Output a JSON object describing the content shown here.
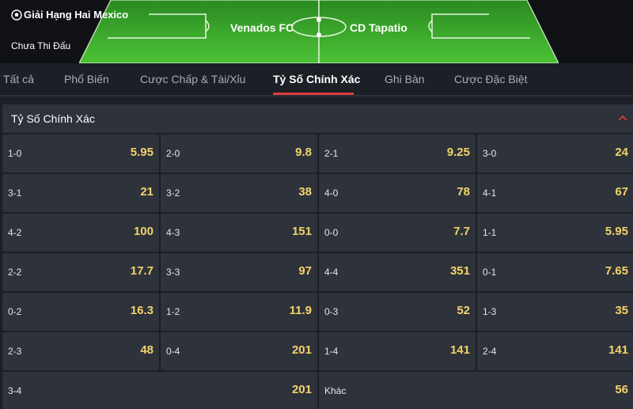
{
  "match": {
    "league": "Giải Hạng Hai Mexico",
    "status": "Chưa Thi Đấu",
    "home_team": "Venados FC",
    "away_team": "CD Tapatio",
    "league_icon": "soccer-ball-icon"
  },
  "tabs": [
    {
      "label": "Tất cả",
      "active": false
    },
    {
      "label": "Phổ Biến",
      "active": false
    },
    {
      "label": "Cược Chấp & Tài/Xỉu",
      "active": false
    },
    {
      "label": "Tỷ Số Chính Xác",
      "active": true
    },
    {
      "label": "Ghi Bàn",
      "active": false
    },
    {
      "label": "Cược Đặc Biệt",
      "active": false
    }
  ],
  "section": {
    "title": "Tỷ Số Chính Xác",
    "collapse_icon": "chevron-up-icon"
  },
  "scores": [
    {
      "score": "1-0",
      "odd": "5.95"
    },
    {
      "score": "2-0",
      "odd": "9.8"
    },
    {
      "score": "2-1",
      "odd": "9.25"
    },
    {
      "score": "3-0",
      "odd": "24"
    },
    {
      "score": "3-1",
      "odd": "21"
    },
    {
      "score": "3-2",
      "odd": "38"
    },
    {
      "score": "4-0",
      "odd": "78"
    },
    {
      "score": "4-1",
      "odd": "67"
    },
    {
      "score": "4-2",
      "odd": "100"
    },
    {
      "score": "4-3",
      "odd": "151"
    },
    {
      "score": "0-0",
      "odd": "7.7"
    },
    {
      "score": "1-1",
      "odd": "5.95"
    },
    {
      "score": "2-2",
      "odd": "17.7"
    },
    {
      "score": "3-3",
      "odd": "97"
    },
    {
      "score": "4-4",
      "odd": "351"
    },
    {
      "score": "0-1",
      "odd": "7.65"
    },
    {
      "score": "0-2",
      "odd": "16.3"
    },
    {
      "score": "1-2",
      "odd": "11.9"
    },
    {
      "score": "0-3",
      "odd": "52"
    },
    {
      "score": "1-3",
      "odd": "35"
    },
    {
      "score": "2-3",
      "odd": "48"
    },
    {
      "score": "0-4",
      "odd": "201"
    },
    {
      "score": "1-4",
      "odd": "141"
    },
    {
      "score": "2-4",
      "odd": "141"
    },
    {
      "score": "3-4",
      "odd": "201"
    },
    {
      "score": "Khác",
      "odd": "56"
    }
  ],
  "colors": {
    "accent": "#e23b3b",
    "odd_text": "#f2d36b",
    "pitch": "#3fae2e"
  }
}
